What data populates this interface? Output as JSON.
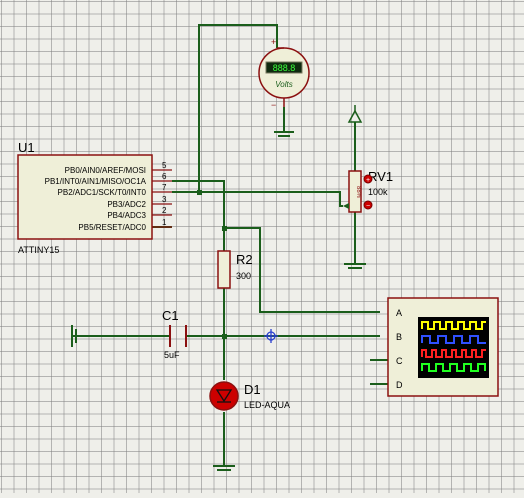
{
  "colors": {
    "wire": "#1b5e1b",
    "component": "#8b1010",
    "ic_body": "#efefd8",
    "ground_bar": "#1b5e1b",
    "canvas_bg": "#efefea"
  },
  "u1": {
    "ref": "U1",
    "part": "ATTINY15",
    "pins": [
      {
        "label": "PB0/AIN0/AREF/MOSI",
        "number": "5"
      },
      {
        "label": "PB1/INT0/AIN1/MISO/OC1A",
        "number": "6"
      },
      {
        "label": "PB2/ADC1/SCK/T0/INT0",
        "number": "7"
      },
      {
        "label": "PB3/ADC2",
        "number": "3"
      },
      {
        "label": "PB4/ADC3",
        "number": "2"
      },
      {
        "label": "PB5/RESET/ADC0",
        "number": "1"
      }
    ]
  },
  "voltmeter": {
    "plus": "+",
    "minus": "−",
    "display": "888.8",
    "unit": "Volts"
  },
  "rv1": {
    "ref": "RV1",
    "value": "100k",
    "pot_label": "88%"
  },
  "r2": {
    "ref": "R2",
    "value": "300"
  },
  "c1": {
    "ref": "C1",
    "value": "5uF"
  },
  "d1": {
    "ref": "D1",
    "value": "LED-AQUA"
  },
  "scope": {
    "channels": [
      "A",
      "B",
      "C",
      "D"
    ]
  }
}
